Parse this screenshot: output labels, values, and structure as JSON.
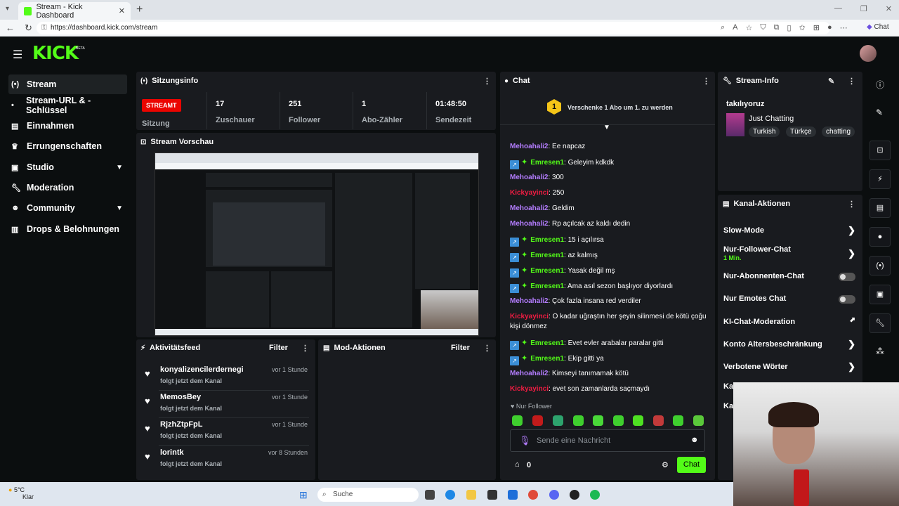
{
  "browser": {
    "tab_title": "Stream - Kick Dashboard",
    "url": "https://dashboard.kick.com/stream",
    "copilot_label": "Chat"
  },
  "header": {
    "logo": "KICK",
    "beta": "BETA"
  },
  "sidebar": {
    "items": [
      {
        "label": "Stream"
      },
      {
        "label": "Stream-URL & -Schlüssel"
      },
      {
        "label": "Einnahmen"
      },
      {
        "label": "Errungenschaften"
      },
      {
        "label": "Studio"
      },
      {
        "label": "Moderation"
      },
      {
        "label": "Community"
      },
      {
        "label": "Drops & Belohnungen"
      }
    ]
  },
  "session": {
    "title": "Sitzungsinfo",
    "status": "STREAMT",
    "status_label": "Sitzung",
    "stats": [
      {
        "value": "17",
        "label": "Zuschauer"
      },
      {
        "value": "251",
        "label": "Follower"
      },
      {
        "value": "1",
        "label": "Abo-Zähler"
      },
      {
        "value": "01:48:50",
        "label": "Sendezeit"
      }
    ]
  },
  "preview": {
    "title": "Stream Vorschau"
  },
  "activity": {
    "title": "Aktivitätsfeed",
    "filter": "Filter",
    "items": [
      {
        "name": "konyalizencilerdernegi",
        "sub": "folgt jetzt dem Kanal",
        "time": "vor 1 Stunde"
      },
      {
        "name": "MemosBey",
        "sub": "folgt jetzt dem Kanal",
        "time": "vor 1 Stunde"
      },
      {
        "name": "RjzhZtpFpL",
        "sub": "folgt jetzt dem Kanal",
        "time": "vor 1 Stunde"
      },
      {
        "name": "lorintk",
        "sub": "folgt jetzt dem Kanal",
        "time": "vor 8 Stunden"
      }
    ]
  },
  "mod": {
    "title": "Mod-Aktionen",
    "filter": "Filter"
  },
  "chat": {
    "title": "Chat",
    "sub_banner": "Verschenke 1 Abo um 1. zu werden",
    "sub_rank": "1",
    "messages": [
      {
        "user": "Mehoahali2",
        "color": "purple",
        "badges": false,
        "text": "Ee napcaz"
      },
      {
        "user": "Emresen1",
        "color": "green",
        "badges": true,
        "text": "Geleyim kdkdk"
      },
      {
        "user": "Mehoahali2",
        "color": "purple",
        "badges": false,
        "text": "300"
      },
      {
        "user": "Kickyayinci",
        "color": "red",
        "badges": false,
        "text": "250"
      },
      {
        "user": "Mehoahali2",
        "color": "purple",
        "badges": false,
        "text": "Geldim"
      },
      {
        "user": "Mehoahali2",
        "color": "purple",
        "badges": false,
        "text": "Rp açılcak az kaldı dedin"
      },
      {
        "user": "Emresen1",
        "color": "green",
        "badges": true,
        "text": "15 i açılırsa"
      },
      {
        "user": "Emresen1",
        "color": "green",
        "badges": true,
        "text": "az kalmış"
      },
      {
        "user": "Emresen1",
        "color": "green",
        "badges": true,
        "text": "Yasak değil mş"
      },
      {
        "user": "Emresen1",
        "color": "green",
        "badges": true,
        "text": "Ama asıl sezon başlıyor diyorlardı"
      },
      {
        "user": "Mehoahali2",
        "color": "purple",
        "badges": false,
        "text": "Çok fazla insana red verdiler"
      },
      {
        "user": "Kickyayinci",
        "color": "red",
        "badges": false,
        "text": "O kadar uğraştın her şeyin silinmesi de kötü çoğu kişi dönmez"
      },
      {
        "user": "Emresen1",
        "color": "green",
        "badges": true,
        "text": "Evet evler arabalar paralar gitti"
      },
      {
        "user": "Emresen1",
        "color": "green",
        "badges": true,
        "text": "Ekip gitti ya"
      },
      {
        "user": "Mehoahali2",
        "color": "purple",
        "badges": false,
        "text": "Kimseyi tanımamak kötü"
      },
      {
        "user": "Kickyayinci",
        "color": "red",
        "badges": false,
        "text": "evet son zamanlarda saçmaydı"
      }
    ],
    "mode": "Nur Follower",
    "input_placeholder": "Sende eine Nachricht",
    "points": "0",
    "send_label": "Chat"
  },
  "stream_info": {
    "title": "Stream-Info",
    "stream_title": "takılıyoruz",
    "category": "Just Chatting",
    "tags": [
      "Turkish",
      "Türkçe",
      "chatting"
    ]
  },
  "channel_actions": {
    "title": "Kanal-Aktionen",
    "rows": [
      {
        "label": "Slow-Mode",
        "kind": "chevron"
      },
      {
        "label": "Nur-Follower-Chat",
        "sub": "1 Min.",
        "kind": "chevron"
      },
      {
        "label": "Nur-Abonnenten-Chat",
        "kind": "toggle"
      },
      {
        "label": "Nur Emotes Chat",
        "kind": "toggle"
      },
      {
        "label": "KI-Chat-Moderation",
        "kind": "external"
      },
      {
        "label": "Konto Altersbeschränkung",
        "kind": "chevron"
      },
      {
        "label": "Verbotene Wörter",
        "kind": "chevron"
      },
      {
        "label": "Ka"
      },
      {
        "label": "Ka"
      }
    ]
  },
  "taskbar": {
    "temp": "5°C",
    "weather": "Klar",
    "search": "Suche"
  },
  "colors": {
    "brand": "#53fc18",
    "live": "#eb0400",
    "panel": "#191b1f"
  }
}
